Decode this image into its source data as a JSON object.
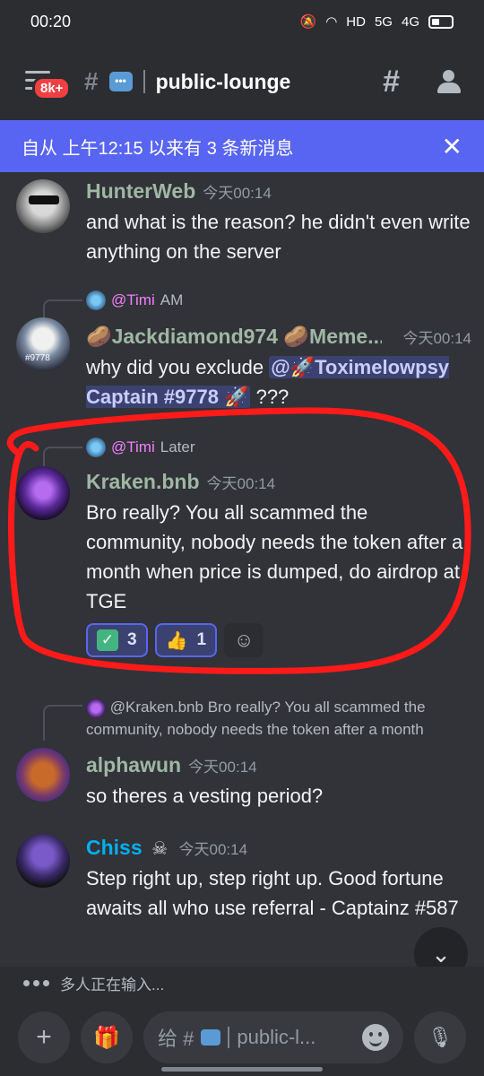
{
  "status_bar": {
    "time": "00:20",
    "network": "5G",
    "network2": "4G",
    "hd": "HD"
  },
  "header": {
    "unread_badge": "8k+",
    "channel_name": "public-lounge",
    "channel_emoji": "💬"
  },
  "banner": {
    "text": "自从 上午12:15 以来有 3 条新消息",
    "close": "✕"
  },
  "messages": [
    {
      "username": "HunterWeb",
      "username_color": "#9fb7a4",
      "timestamp": "今天00:14",
      "text": "and what is the reason? he didn't even write anything on the server"
    },
    {
      "reply_mention": "@Timi",
      "reply_text": "AM",
      "username": "🥔Jackdiamond974 🥔Meme...",
      "username_color": "#9fb7a4",
      "timestamp": "今天00:14",
      "text_before": "why did you exclude ",
      "mention": "@🚀Toximelowpsy Captain #9778 🚀",
      "text_after": " ???"
    },
    {
      "reply_mention": "@Timi",
      "reply_text": "Later",
      "username": "Kraken.bnb",
      "username_color": "#9fb7a4",
      "timestamp": "今天00:14",
      "text": "Bro really? You all scammed the community, nobody needs the token after a month when price is dumped, do airdrop at TGE",
      "reactions": [
        {
          "emoji": "✓",
          "count": "3"
        },
        {
          "emoji": "👍",
          "count": "1"
        }
      ]
    },
    {
      "reply_mention": "@Kraken.bnb",
      "reply_text": "Bro really? You all scammed the community, nobody needs the token after a month",
      "username": "alphawun",
      "username_color": "#9fb7a4",
      "timestamp": "今天00:14",
      "text": "so theres a vesting period?"
    },
    {
      "username": "Chiss",
      "username_color": "#00b0f4",
      "username_icon": "☠",
      "timestamp": "今天00:14",
      "text": "Step right up, step right up. Good fortune awaits all who use referral - Captainz #587"
    }
  ],
  "typing": {
    "text": "多人正在输入..."
  },
  "composer": {
    "placeholder_prefix": "给 #",
    "placeholder_channel": "public-l..."
  },
  "colors": {
    "accent": "#5865f2",
    "background": "#313338",
    "annotation": "#ff1a1a"
  }
}
